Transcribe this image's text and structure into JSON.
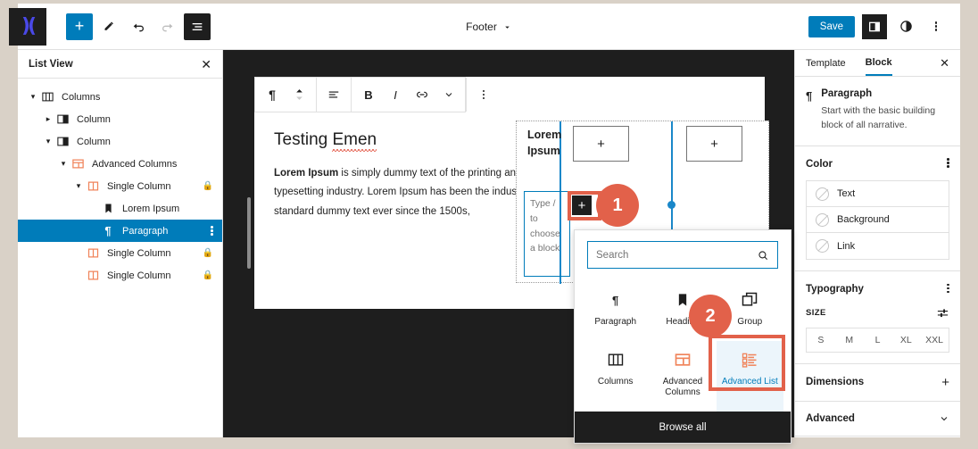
{
  "topbar": {
    "logo_icon": "brand-logo-icon",
    "add_block_button": "+",
    "tools": [
      {
        "name": "add-block",
        "glyph": "+"
      },
      {
        "name": "edit-pencil",
        "glyph": "pencil-icon"
      },
      {
        "name": "undo",
        "glyph": "undo-icon"
      },
      {
        "name": "redo",
        "glyph": "redo-icon"
      },
      {
        "name": "list-view",
        "glyph": "list-view-icon"
      }
    ],
    "document_title": "Footer",
    "save_label": "Save",
    "settings_icon": "sidebar-toggle-icon",
    "contrast_icon": "contrast-icon",
    "more_icon": "more-options-icon"
  },
  "list_view": {
    "title": "List View",
    "close_icon": "close-icon",
    "items": [
      {
        "label": "Columns",
        "indent": 0,
        "chevron": "down",
        "icon": "columns-icon",
        "locked": false,
        "selected": false
      },
      {
        "label": "Column",
        "indent": 1,
        "chevron": "right",
        "icon": "column-icon",
        "locked": false,
        "selected": false
      },
      {
        "label": "Column",
        "indent": 1,
        "chevron": "down",
        "icon": "column-icon",
        "locked": false,
        "selected": false
      },
      {
        "label": "Advanced Columns",
        "indent": 2,
        "chevron": "down",
        "icon": "advanced-columns-icon",
        "locked": false,
        "selected": false
      },
      {
        "label": "Single Column",
        "indent": 3,
        "chevron": "down",
        "icon": "single-column-icon",
        "locked": true,
        "selected": false
      },
      {
        "label": "Lorem Ipsum",
        "indent": 4,
        "chevron": "none",
        "icon": "heading-bookmark-icon",
        "locked": false,
        "selected": false
      },
      {
        "label": "Paragraph",
        "indent": 4,
        "chevron": "none",
        "icon": "paragraph-icon",
        "locked": false,
        "selected": true
      },
      {
        "label": "Single Column",
        "indent": 3,
        "chevron": "none",
        "icon": "single-column-icon",
        "locked": true,
        "selected": false
      },
      {
        "label": "Single Column",
        "indent": 3,
        "chevron": "none",
        "icon": "single-column-icon",
        "locked": true,
        "selected": false
      }
    ]
  },
  "editor": {
    "block_toolbar": [
      {
        "name": "paragraph-type-icon",
        "glyph": "¶"
      },
      {
        "name": "move-updown-icon",
        "glyph": "updown"
      },
      {
        "name": "align-icon",
        "glyph": "align"
      },
      {
        "name": "bold-icon",
        "glyph": "B"
      },
      {
        "name": "italic-icon",
        "glyph": "I"
      },
      {
        "name": "link-icon",
        "glyph": "link"
      },
      {
        "name": "more-formats-icon",
        "glyph": "chevron-down"
      },
      {
        "name": "block-options-icon",
        "glyph": "kebab"
      }
    ],
    "heading": "Testing ",
    "heading_misspelled": "Emen",
    "paragraph_bold": "Lorem Ipsum",
    "paragraph_rest": " is simply dummy text of the printing and typesetting industry. Lorem Ipsum has been the industry's standard dummy text ever since the 1500s,",
    "advanced_columns": {
      "heading": "Lorem Ipsum",
      "placeholder": "Type / to choose a block",
      "plus_glyph": "+",
      "adder_glyph": "+"
    }
  },
  "inserter": {
    "search_value": "",
    "search_placeholder": "Search",
    "search_icon": "search-icon",
    "blocks": [
      {
        "label": "Paragraph",
        "icon": "paragraph-icon",
        "highlight": false
      },
      {
        "label": "Heading",
        "icon": "heading-icon",
        "highlight": false
      },
      {
        "label": "Group",
        "icon": "group-icon",
        "highlight": false
      },
      {
        "label": "Columns",
        "icon": "columns-icon",
        "highlight": false
      },
      {
        "label": "Advanced Columns",
        "icon": "advanced-columns-icon",
        "highlight": false
      },
      {
        "label": "Advanced List",
        "icon": "advanced-list-icon",
        "highlight": true
      }
    ],
    "browse_all": "Browse all"
  },
  "annotations": [
    {
      "number": "1"
    },
    {
      "number": "2"
    }
  ],
  "sidebar": {
    "tabs": [
      {
        "label": "Template",
        "active": false
      },
      {
        "label": "Block",
        "active": true
      }
    ],
    "close_icon": "close-icon",
    "block": {
      "icon": "paragraph-icon",
      "title": "Paragraph",
      "description": "Start with the basic building block of all narrative."
    },
    "color": {
      "title": "Color",
      "more_icon": "more-options-icon",
      "rows": [
        {
          "label": "Text"
        },
        {
          "label": "Background"
        },
        {
          "label": "Link"
        }
      ]
    },
    "typography": {
      "title": "Typography",
      "more_icon": "more-options-icon",
      "size_label": "SIZE",
      "size_settings_icon": "sliders-icon",
      "sizes": [
        "S",
        "M",
        "L",
        "XL",
        "XXL"
      ]
    },
    "dimensions": {
      "title": "Dimensions",
      "icon": "plus-icon"
    },
    "advanced": {
      "title": "Advanced",
      "icon": "chevron-down-icon"
    }
  },
  "colors": {
    "accent_blue": "#007cba",
    "badge_orange": "#e2614a",
    "dark": "#1e1e1e",
    "page_bg": "#d9d1c7",
    "orange_block": "#f0845b"
  }
}
